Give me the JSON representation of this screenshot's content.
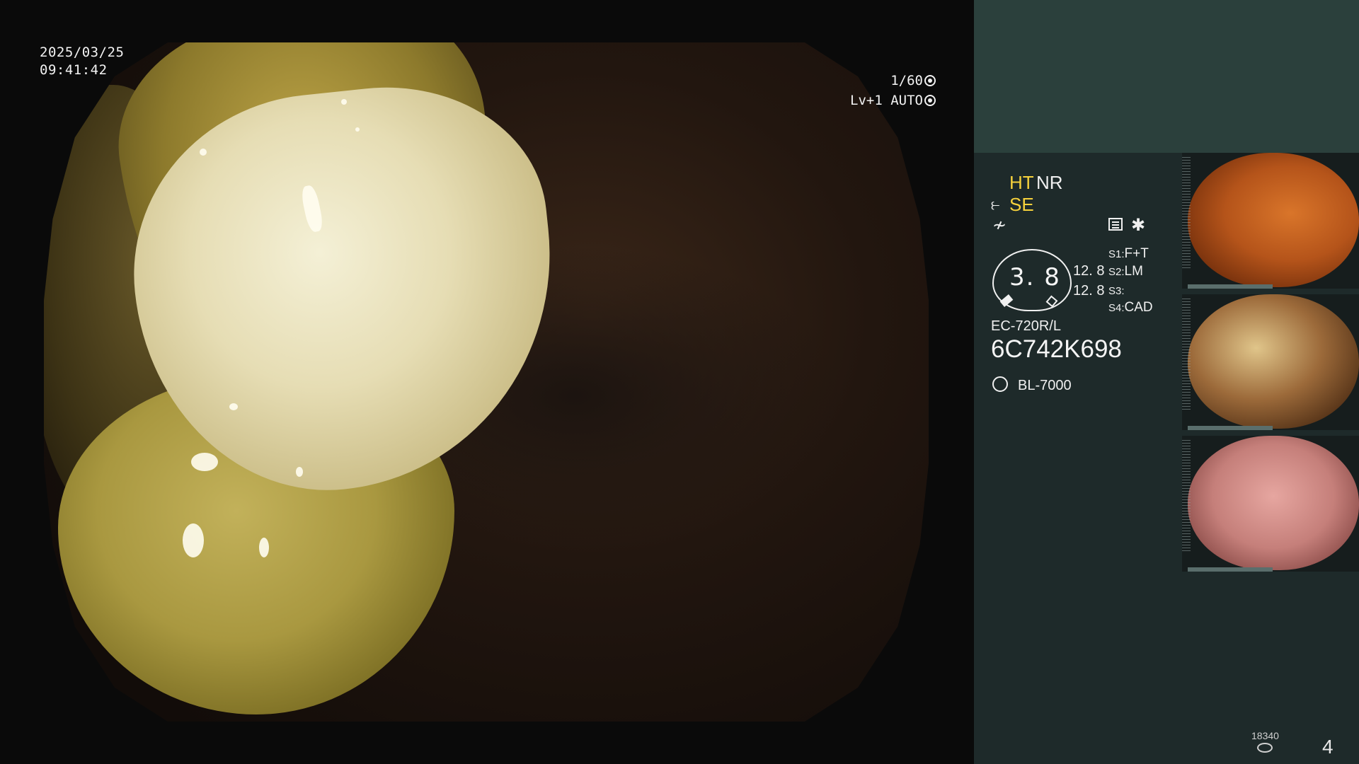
{
  "overlay": {
    "date": "2025/03/25",
    "time": "09:41:42",
    "shutter": "1/60",
    "exposure_level": "Lv+1",
    "exposure_mode": "AUTO"
  },
  "panel": {
    "modes": {
      "ht": "HT",
      "nr": "NR",
      "se": "SE"
    },
    "gauge_value": "3. 8",
    "value_a": "12. 8",
    "value_b": "12. 8",
    "slots": [
      {
        "key": "S1:",
        "value": "F+T"
      },
      {
        "key": "S2:",
        "value": "LM"
      },
      {
        "key": "S3:",
        "value": ""
      },
      {
        "key": "S4:",
        "value": "CAD"
      }
    ],
    "scope_model": "EC-720R/L",
    "scope_serial": "6C742K698",
    "light_source": "BL-7000",
    "storage_count": "18340",
    "page": "4"
  },
  "colors": {
    "accent_yellow": "#f7d23c",
    "panel_bg": "#1e2a2a",
    "panel_top_bg": "#2b403c"
  }
}
